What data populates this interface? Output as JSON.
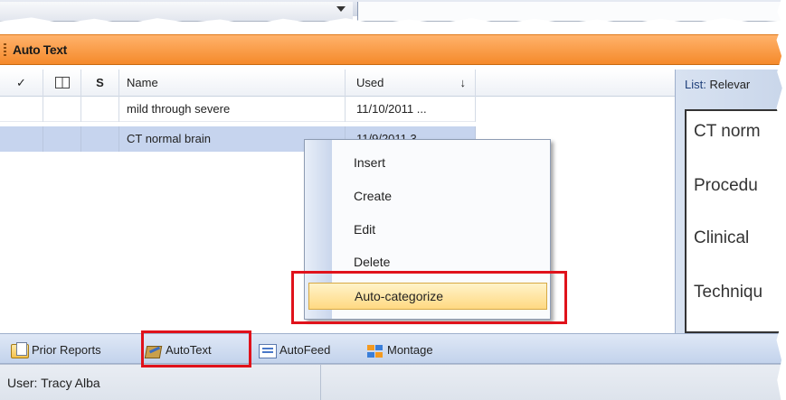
{
  "panel": {
    "title": "Auto Text"
  },
  "columns": {
    "check": "✓",
    "s": "S",
    "name": "Name",
    "used": "Used",
    "sort_indicator": "↓"
  },
  "rows": [
    {
      "name": "mild through severe",
      "used": "11/10/2011 ..."
    },
    {
      "name": "CT normal brain",
      "used": "11/9/2011 3..."
    }
  ],
  "right_panel": {
    "list_label": "List:",
    "list_value": "Relevar",
    "doc_lines": [
      "CT norm",
      "Procedu",
      "Clinical",
      "Techniqu"
    ]
  },
  "context_menu": {
    "items": [
      "Insert",
      "Create",
      "Edit",
      "Delete",
      "Auto-categorize"
    ],
    "selected_index": 4
  },
  "tabs": [
    {
      "label": "Prior Reports",
      "icon": "prior-reports-icon"
    },
    {
      "label": "AutoText",
      "icon": "autotext-icon",
      "active": true
    },
    {
      "label": "AutoFeed",
      "icon": "autofeed-icon"
    },
    {
      "label": "Montage",
      "icon": "montage-icon"
    }
  ],
  "status": {
    "user": "User: Tracy Alba"
  },
  "colors": {
    "title_bar": "#f58a2b",
    "selected_row": "#c6d4ee",
    "menu_highlight": "#ffd982",
    "annotation_red": "#e0121b"
  }
}
